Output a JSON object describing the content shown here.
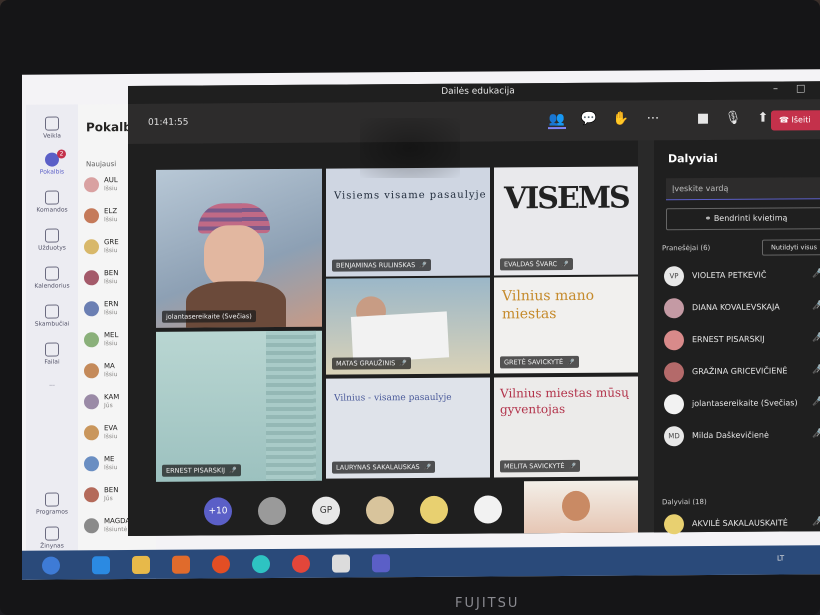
{
  "meeting": {
    "title": "Dailės edukacija",
    "timer": "01:41:55",
    "leave_label": "Išeiti"
  },
  "teams_rail": {
    "items": [
      {
        "label": "Veikla",
        "icon": "bell-icon"
      },
      {
        "label": "Pokalbis",
        "icon": "chat-icon",
        "badge": "2"
      },
      {
        "label": "Komandos",
        "icon": "teams-icon"
      },
      {
        "label": "Užduotys",
        "icon": "assignments-icon"
      },
      {
        "label": "Kalendorius",
        "icon": "calendar-icon"
      },
      {
        "label": "Skambučiai",
        "icon": "phone-icon"
      },
      {
        "label": "Failai",
        "icon": "file-icon"
      },
      {
        "label": "...",
        "icon": "more-icon"
      },
      {
        "label": "Programos",
        "icon": "apps-icon"
      },
      {
        "label": "Žinynas",
        "icon": "help-icon"
      }
    ]
  },
  "chat_list": {
    "title": "Pokalb",
    "section": "Naujausi",
    "rows": [
      {
        "name": "AUL",
        "sub": "Išsiu"
      },
      {
        "name": "ELZ",
        "sub": "Išsiu"
      },
      {
        "name": "GRE",
        "sub": "Išsiu"
      },
      {
        "name": "BEN",
        "sub": "Išsiu"
      },
      {
        "name": "ERN",
        "sub": "Išsiu"
      },
      {
        "name": "MEL",
        "sub": "Išsiu"
      },
      {
        "name": "MA",
        "sub": "Išsiu"
      },
      {
        "name": "KAM",
        "sub": "Jūs"
      },
      {
        "name": "EVA",
        "sub": "Išsiu"
      },
      {
        "name": "ME",
        "sub": "Išsiu"
      },
      {
        "name": "BEN",
        "sub": "Jūs"
      },
      {
        "name": "MAGDALENA STANAITE",
        "sub": "Išsiuntė atvaizdą"
      }
    ]
  },
  "tiles": [
    {
      "name": "jolantasereikaite (Svečias)"
    },
    {
      "name": "BENJAMINAS RULINSKAS",
      "sign": "Visiems visame pasaulyje"
    },
    {
      "name": "EVALDAS ŠVARC",
      "sign": "VISEMS"
    },
    {
      "name": "MATAS GRAUŽINIS"
    },
    {
      "name": "GRETĖ SAVICKYTĖ",
      "sign": "Vilnius mano miestas"
    },
    {
      "name": "ERNEST PISARSKIJ"
    },
    {
      "name": "LAURYNAS SAKALAUSKAS",
      "sign": "Vilnius - visame pasaulyje"
    },
    {
      "name": "MELITA SAVICKYTĖ",
      "sign": "Vilnius miestas mūsų gyventojas"
    }
  ],
  "strip": {
    "more_count": "+10",
    "initials": "GP"
  },
  "roster": {
    "title": "Dalyviai",
    "search_placeholder": "Įveskite vardą",
    "share_label": "Bendrinti kvietimą",
    "presenters_section": "Pranešėjai (6)",
    "mute_all_label": "Nutildyti visus",
    "attendees_section": "Dalyviai (18)",
    "people": [
      {
        "initials": "VP",
        "name": "VIOLETA PETKEVIČ"
      },
      {
        "initials": "",
        "name": "DIANA KOVALEVSKAJA"
      },
      {
        "initials": "",
        "name": "ERNEST PISARSKIJ"
      },
      {
        "initials": "",
        "name": "GRAŽINA GRICEVIČIENĖ"
      },
      {
        "initials": "",
        "name": "jolantasereikaite (Svečias)"
      },
      {
        "initials": "MD",
        "name": "Milda Daškevičienė"
      }
    ],
    "attendee_first": "AKVILĖ SAKALAUSKAITĖ"
  },
  "taskbar": {
    "tray_lang": "LT"
  },
  "device": {
    "brand": "FUJITSU"
  },
  "colors": {
    "teams_purple": "#5b5fc7",
    "leave_red": "#c4314b",
    "taskbar_blue": "#2a4a7a"
  }
}
